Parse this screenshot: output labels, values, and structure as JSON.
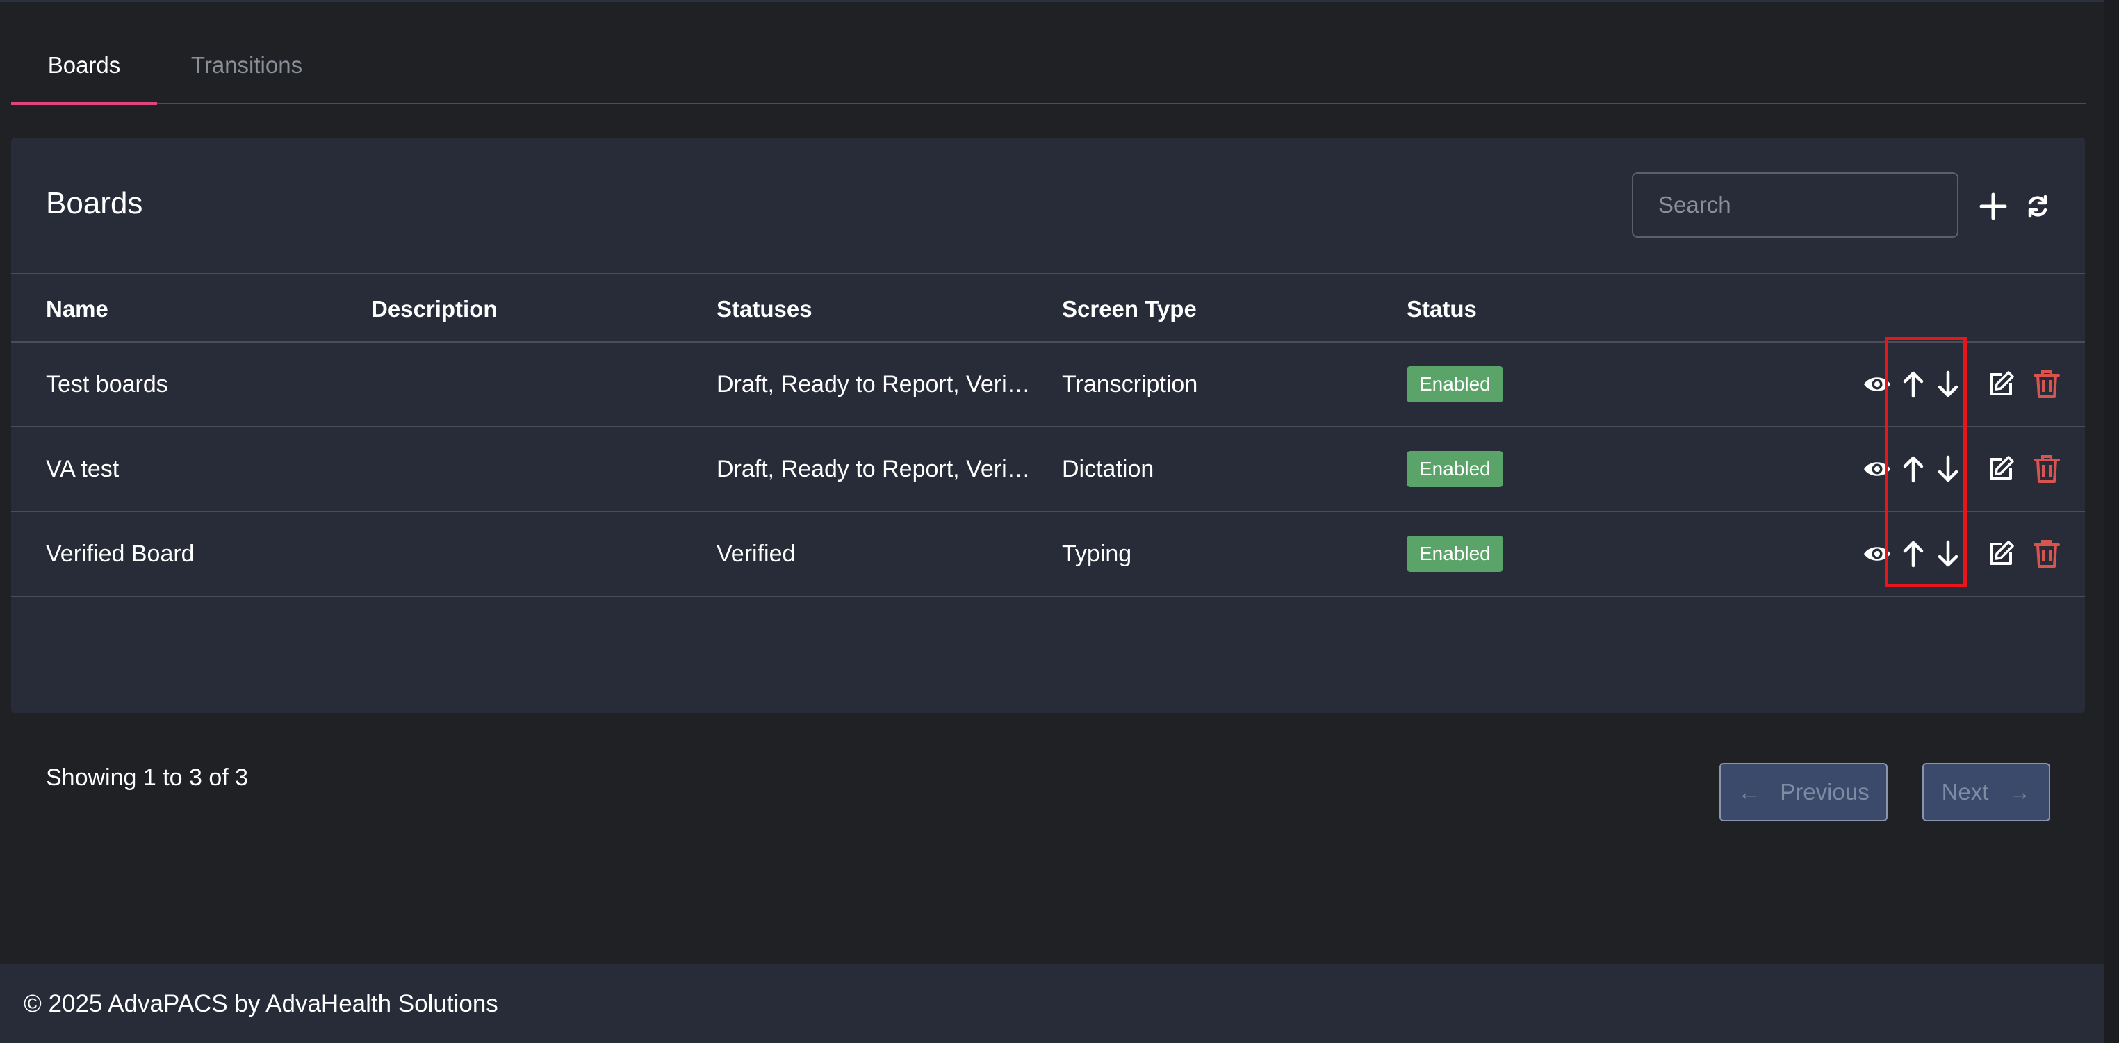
{
  "tabs": [
    {
      "label": "Boards",
      "active": true
    },
    {
      "label": "Transitions",
      "active": false
    }
  ],
  "card": {
    "title": "Boards",
    "search_placeholder": "Search",
    "add_icon": "plus-icon",
    "refresh_icon": "refresh-icon"
  },
  "table": {
    "columns": [
      "Name",
      "Description",
      "Statuses",
      "Screen Type",
      "Status"
    ],
    "rows": [
      {
        "name": "Test boards",
        "description": "",
        "statuses": "Draft, Ready to Report, Veri…",
        "screen_type": "Transcription",
        "status": "Enabled"
      },
      {
        "name": "VA test",
        "description": "",
        "statuses": "Draft, Ready to Report, Veri…",
        "screen_type": "Dictation",
        "status": "Enabled"
      },
      {
        "name": "Verified Board",
        "description": "",
        "statuses": "Verified",
        "screen_type": "Typing",
        "status": "Enabled"
      }
    ],
    "row_actions": [
      "eye-icon",
      "arrow-up-icon",
      "arrow-down-icon",
      "edit-icon",
      "trash-icon"
    ]
  },
  "pagination": {
    "summary": "Showing 1 to 3 of 3",
    "previous_label": "Previous",
    "previous_arrow": "←",
    "next_label": "Next",
    "next_arrow": "→"
  },
  "footer": {
    "text": "© 2025 AdvaPACS by AdvaHealth Solutions"
  },
  "colors": {
    "background": "#202124",
    "card": "#272c38",
    "tab_accent": "#e0457b",
    "badge_enabled": "#5aa469",
    "delete_icon": "#d9534f",
    "highlight_box": "#e8161c",
    "pagination_button": "#3b4a6b"
  }
}
